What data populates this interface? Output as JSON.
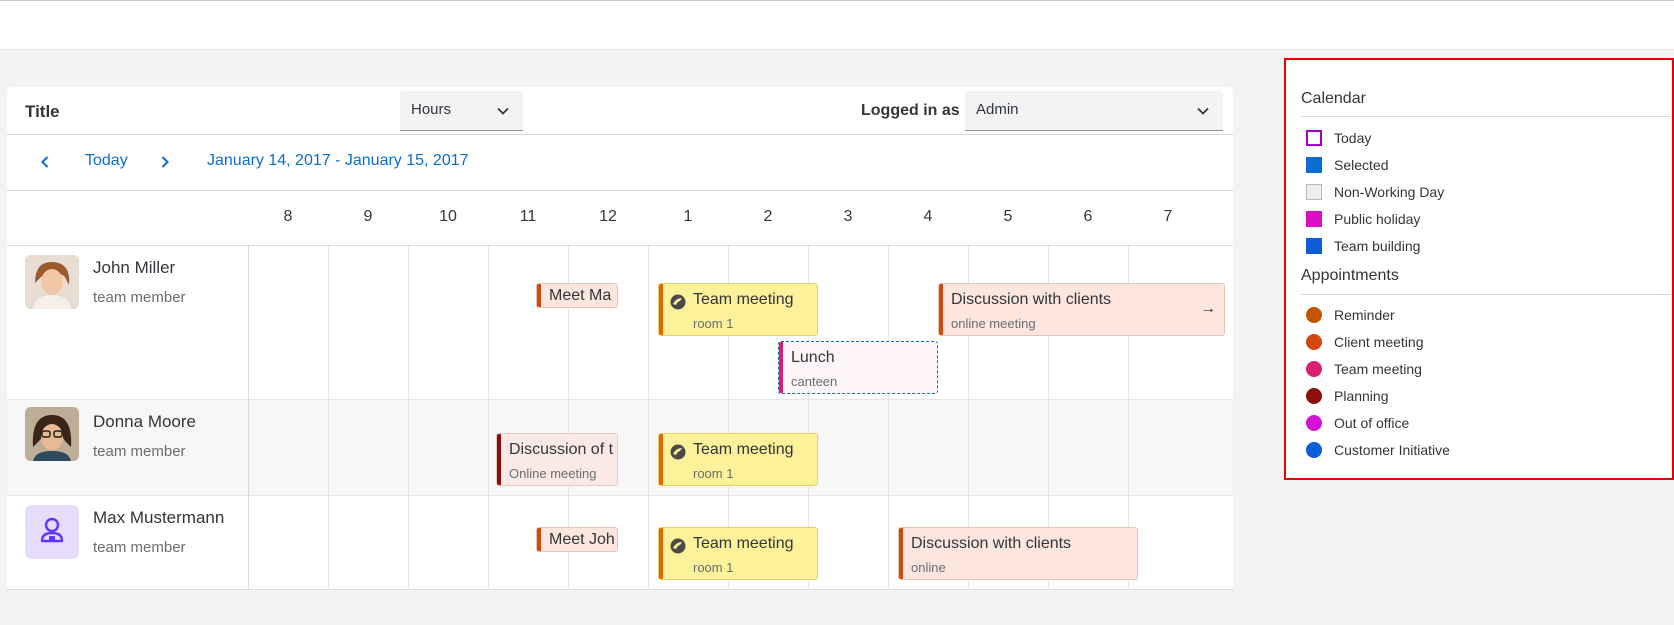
{
  "toolbar": {
    "title": "Title",
    "view_select_value": "Hours",
    "logged_in_label": "Logged in as",
    "user_select_value": "Admin"
  },
  "nav": {
    "today_label": "Today",
    "date_range": "January 14, 2017 - January 15, 2017"
  },
  "hours": [
    "8",
    "9",
    "10",
    "11",
    "12",
    "1",
    "2",
    "3",
    "4",
    "5",
    "6",
    "7"
  ],
  "people": [
    {
      "name": "John Miller",
      "role": "team member"
    },
    {
      "name": "Donna Moore",
      "role": "team member"
    },
    {
      "name": "Max Mustermann",
      "role": "team member"
    }
  ],
  "appointments": {
    "john": [
      {
        "title": "Meet Ma",
        "subtitle": ""
      },
      {
        "title": "Team meeting",
        "subtitle": "room 1"
      },
      {
        "title": "Discussion with clients",
        "subtitle": "online meeting"
      },
      {
        "title": "Lunch",
        "subtitle": "canteen"
      }
    ],
    "donna": [
      {
        "title": "Discussion of t",
        "subtitle": "Online meeting"
      },
      {
        "title": "Team meeting",
        "subtitle": "room 1"
      }
    ],
    "max": [
      {
        "title": "Meet Joh",
        "subtitle": ""
      },
      {
        "title": "Team meeting",
        "subtitle": "room 1"
      },
      {
        "title": "Discussion with clients",
        "subtitle": "online"
      }
    ]
  },
  "legend": {
    "calendar_title": "Calendar",
    "calendar_items": [
      {
        "label": "Today",
        "color": "#a100c2"
      },
      {
        "label": "Selected",
        "color": "#0a6ed1"
      },
      {
        "label": "Non-Working Day",
        "color": "#eeeeee"
      },
      {
        "label": "Public holiday",
        "color": "#d90fc6"
      },
      {
        "label": "Team building",
        "color": "#0e5ed8"
      }
    ],
    "appointments_title": "Appointments",
    "appointment_items": [
      {
        "label": "Reminder",
        "color": "#c35500"
      },
      {
        "label": "Client meeting",
        "color": "#d04a0e"
      },
      {
        "label": "Team meeting",
        "color": "#dc1e70"
      },
      {
        "label": "Planning",
        "color": "#8a0f0f"
      },
      {
        "label": "Out of office",
        "color": "#d413d4"
      },
      {
        "label": "Customer Initiative",
        "color": "#0a5ed6"
      }
    ]
  }
}
